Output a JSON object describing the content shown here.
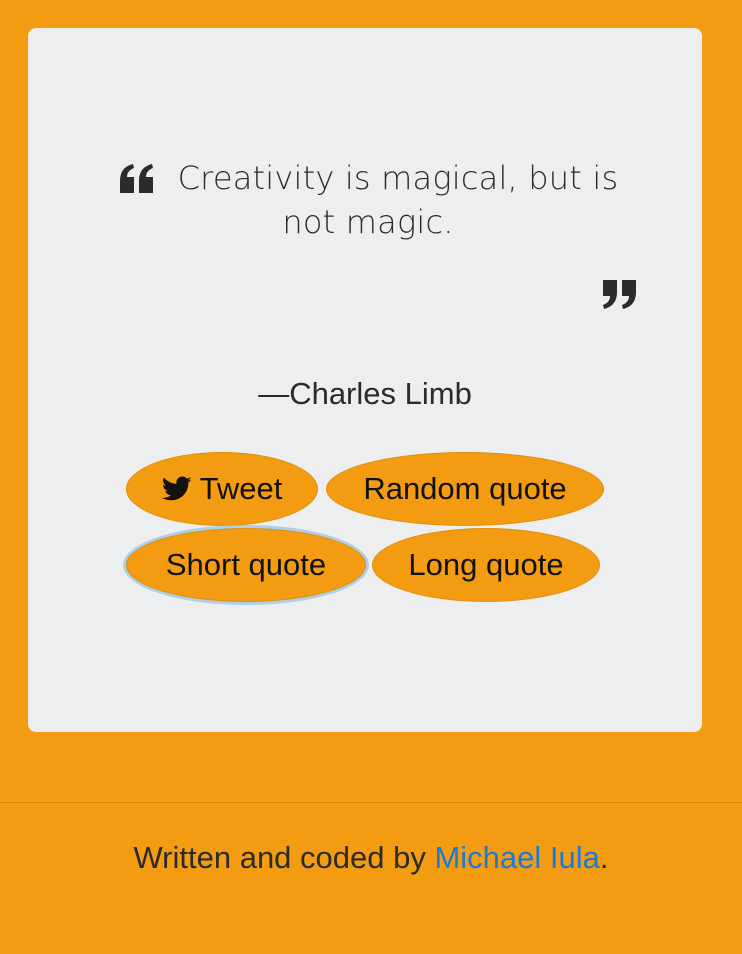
{
  "quote": {
    "text": "Creativity is magical, but is not magic.",
    "author": "—Charles Limb",
    "open_icon": "quote-left-icon",
    "close_icon": "quote-right-icon"
  },
  "buttons": {
    "tweet": {
      "label": "Tweet",
      "icon": "twitter-icon"
    },
    "random": {
      "label": "Random quote"
    },
    "short": {
      "label": "Short quote"
    },
    "long": {
      "label": "Long quote"
    }
  },
  "footer": {
    "prefix": "Written and coded by ",
    "link_text": "Michael Iula",
    "suffix": "."
  },
  "colors": {
    "background": "#f39c12",
    "card": "#eceeef",
    "link": "#1a7ad6",
    "focus_ring": "#8cbee6"
  }
}
